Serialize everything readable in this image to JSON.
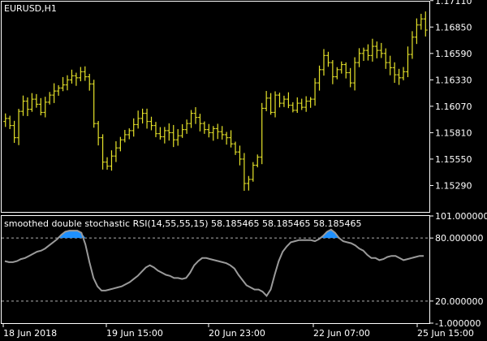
{
  "colors": {
    "background": "#000000",
    "frame": "#ffffff",
    "price_bars": "#e6e32a",
    "oscillator": "#9a9a9a",
    "overbought_fill": "#1e90ff",
    "level_lines": "#b0b0b0",
    "text": "#ffffff"
  },
  "chart_data": [
    {
      "type": "bar",
      "title": "EURUSD,H1",
      "symbol": "EURUSD",
      "timeframe": "H1",
      "ylim": [
        1.1503,
        1.171
      ],
      "yticks": [
        1.1711,
        1.1685,
        1.1659,
        1.1633,
        1.1607,
        1.1581,
        1.1555,
        1.1529
      ],
      "ytick_labels": [
        "1.17110",
        "1.16850",
        "1.16590",
        "1.16330",
        "1.16070",
        "1.15810",
        "1.15550",
        "1.15290"
      ],
      "series": [
        {
          "values": [
            1.1595,
            1.1588,
            1.1576,
            1.1602,
            1.1612,
            1.1604,
            1.1614,
            1.1609,
            1.1601,
            1.1611,
            1.1618,
            1.1622,
            1.1625,
            1.1628,
            1.1633,
            1.1637,
            1.1635,
            1.1641,
            1.1636,
            1.1629,
            1.159,
            1.1576,
            1.1552,
            1.1548,
            1.1558,
            1.1566,
            1.1574,
            1.1579,
            1.1583,
            1.1589,
            1.1595,
            1.16,
            1.1592,
            1.1588,
            1.158,
            1.1577,
            1.1583,
            1.1581,
            1.1574,
            1.1578,
            1.1584,
            1.159,
            1.16,
            1.1596,
            1.159,
            1.1584,
            1.1581,
            1.1585,
            1.1582,
            1.1579,
            1.1576,
            1.157,
            1.1562,
            1.1555,
            1.1531,
            1.1535,
            1.1549,
            1.1557,
            1.1605,
            1.1615,
            1.1601,
            1.1618,
            1.161,
            1.1614,
            1.1608,
            1.1603,
            1.161,
            1.1606,
            1.1612,
            1.1614,
            1.163,
            1.1643,
            1.1657,
            1.165,
            1.1636,
            1.1643,
            1.1648,
            1.164,
            1.163,
            1.165,
            1.1659,
            1.1662,
            1.1657,
            1.1666,
            1.1662,
            1.1659,
            1.165,
            1.1645,
            1.1638,
            1.1635,
            1.1641,
            1.1658,
            1.1675,
            1.1687,
            1.1693,
            1.1682
          ]
        }
      ]
    },
    {
      "type": "line",
      "title": "smoothed double stochastic RSI(14,55,55,15) 58.185465 58.185465 58.185465",
      "ylim": [
        -1.0,
        101.0
      ],
      "levels": [
        80.0,
        20.0
      ],
      "ytick_labels": [
        "101.000000",
        "80.000000",
        "20.000000",
        "-1.000000"
      ],
      "series": [
        {
          "values": [
            58,
            57,
            57,
            58,
            60,
            61,
            63,
            65,
            67,
            68,
            70,
            73,
            76,
            79,
            83,
            86,
            87,
            87,
            87,
            85,
            74,
            57,
            42,
            34,
            30,
            30,
            31,
            32,
            33,
            34,
            36,
            38,
            41,
            44,
            48,
            52,
            54,
            52,
            49,
            47,
            45,
            44,
            42,
            42,
            41,
            42,
            47,
            54,
            58,
            61,
            61,
            60,
            59,
            58,
            57,
            56,
            54,
            51,
            45,
            40,
            35,
            33,
            31,
            31,
            29,
            25,
            31,
            45,
            58,
            67,
            72,
            76,
            77,
            78,
            78,
            78,
            78,
            77,
            79,
            82,
            86,
            88,
            85,
            80,
            77,
            76,
            75,
            73,
            70,
            68,
            64,
            61,
            61,
            59,
            60,
            62,
            63,
            63,
            61,
            59,
            60,
            61,
            62,
            63,
            63
          ]
        }
      ]
    }
  ],
  "x_axis": {
    "tick_labels": [
      "18 Jun 2018",
      "19 Jun 15:00",
      "20 Jun 23:00",
      "22 Jun 07:00",
      "25 Jun 15:00"
    ]
  }
}
